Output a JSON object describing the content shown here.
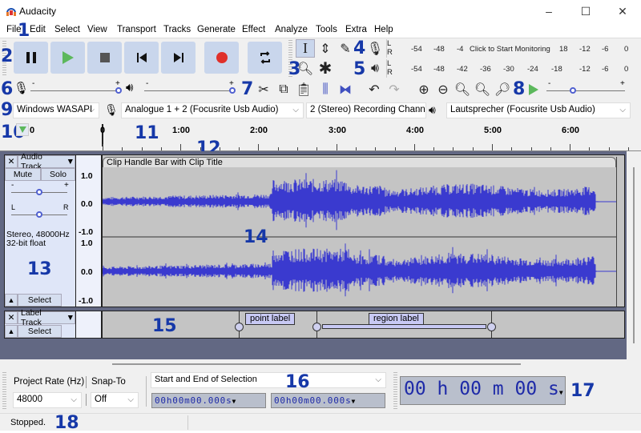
{
  "window": {
    "title": "Audacity",
    "minimize": "–",
    "maximize": "☐",
    "close": "✕"
  },
  "menu": [
    "File",
    "Edit",
    "Select",
    "View",
    "Transport",
    "Tracks",
    "Generate",
    "Effect",
    "Analyze",
    "Tools",
    "Extra",
    "Help"
  ],
  "annotations": [
    "1",
    "2",
    "3",
    "4",
    "5",
    "6",
    "7",
    "8",
    "9",
    "10",
    "11",
    "12",
    "13",
    "14",
    "15",
    "16",
    "17",
    "18"
  ],
  "transport": {
    "buttons": [
      "pause-icon",
      "play-icon",
      "stop-icon",
      "skip-start-icon",
      "skip-end-icon",
      "record-icon",
      "loop-icon"
    ],
    "play_color": "#5cb85c",
    "record_color": "#e0302a"
  },
  "tools": [
    "selection-tool-icon",
    "envelope-tool-icon",
    "draw-tool-icon",
    "zoom-tool-icon",
    "multi-tool-icon"
  ],
  "meters": {
    "record": {
      "label_l": "L",
      "label_r": "R",
      "ticks": [
        "-54",
        "-48",
        "-4"
      ],
      "prompt": "Click to Start Monitoring",
      "ticks_right": [
        "18",
        "-12",
        "-6",
        "0"
      ]
    },
    "playback": {
      "label_l": "L",
      "label_r": "R",
      "ticks": [
        "-54",
        "-48",
        "-42",
        "-36",
        "-30",
        "-24",
        "-18",
        "-12",
        "-6",
        "0"
      ]
    }
  },
  "mixer": {
    "rec_minus": "-",
    "rec_plus": "+",
    "play_minus": "-",
    "play_plus": "+",
    "rec_volume": 1.0,
    "play_volume": 1.0
  },
  "playat_speed": {
    "minus": "-",
    "plus": "+",
    "value": 0.33
  },
  "devices": {
    "host": "Windows WASAPI",
    "input": "Analogue 1 + 2 (Focusrite Usb Audio)",
    "channels": "2 (Stereo) Recording Chann",
    "output": "Lautsprecher (Focusrite Usb Audio)"
  },
  "ruler": {
    "labels": [
      "0",
      "0",
      "1:00",
      "2:00",
      "3:00",
      "4:00",
      "5:00",
      "6:00"
    ]
  },
  "audio_track": {
    "name": "Audio Track",
    "close": "✕",
    "mute": "Mute",
    "solo": "Solo",
    "gain_minus": "-",
    "gain_plus": "+",
    "pan_l": "L",
    "pan_r": "R",
    "gain": 0.5,
    "pan": 0.5,
    "info1": "Stereo, 48000Hz",
    "info2": "32-bit float",
    "select": "Select",
    "clip_title": "Clip Handle Bar with Clip Title",
    "scale": [
      "1.0",
      "0.0",
      "-1.0",
      "1.0",
      "0.0",
      "-1.0"
    ],
    "wave_color": "#3a3acf"
  },
  "label_track": {
    "name": "Label Track",
    "close": "✕",
    "select": "Select",
    "point_label": "point label",
    "region_label": "region label"
  },
  "selection_bar": {
    "rate_label": "Project Rate (Hz)",
    "rate_value": "48000",
    "snap_label": "Snap-To",
    "snap_value": "Off",
    "sel_mode": "Start and End of Selection",
    "start": "00h00m00.000s",
    "end": "00h00m00.000s"
  },
  "time_display": {
    "value": "00 h 00 m 00 s"
  },
  "status": {
    "text": "Stopped."
  }
}
